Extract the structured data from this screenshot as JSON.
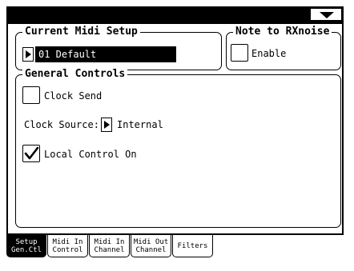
{
  "header": {
    "menu_icon": "triangle-down-icon"
  },
  "current_midi_setup": {
    "title": "Current Midi Setup",
    "value": "01 Default"
  },
  "note_to_rxnoise": {
    "title": "Note to RXnoise",
    "enable_label": "Enable",
    "enabled": false
  },
  "general_controls": {
    "title": "General Controls",
    "clock_send_label": "Clock Send",
    "clock_send_checked": false,
    "clock_source_label": "Clock Source:",
    "clock_source_value": "Internal",
    "local_control_label": "Local Control On",
    "local_control_checked": true
  },
  "tabs": [
    {
      "line1": "Setup",
      "line2": "Gen.Ctl",
      "active": true
    },
    {
      "line1": "Midi In",
      "line2": "Control",
      "active": false
    },
    {
      "line1": "Midi In",
      "line2": "Channel",
      "active": false
    },
    {
      "line1": "Midi Out",
      "line2": "Channel",
      "active": false
    },
    {
      "line1": "Filters",
      "line2": "",
      "active": false
    }
  ]
}
